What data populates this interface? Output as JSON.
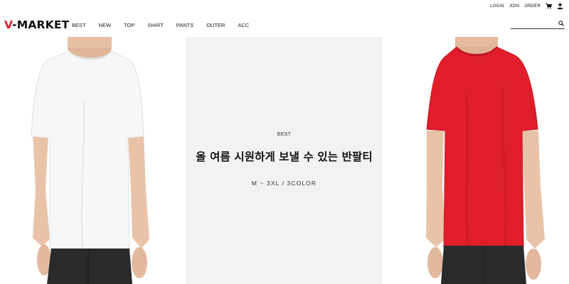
{
  "util_bar": {
    "login": "LOGIN",
    "join": "JOIN",
    "order": "ORDER",
    "icons": [
      "cart-icon",
      "user-icon"
    ]
  },
  "header": {
    "logo_prefix": "V",
    "logo_rest": "-MARKET",
    "nav": [
      "BEST",
      "NEW",
      "TOP",
      "SHIRT",
      "PANTS",
      "OUTER",
      "ACC"
    ],
    "search": {
      "value": "",
      "placeholder": "",
      "icon": "search-icon"
    }
  },
  "hero": {
    "eyebrow": "BEST",
    "headline": "올 여름 시원하게 보낼 수 있는 반팔티",
    "subline": "M ~ 3XL / 3COLOR",
    "left_image": "model-white-tshirt",
    "right_image": "model-red-tshirt"
  },
  "colors": {
    "brand_accent": "#e01f2d",
    "center_panel_bg": "#f2f2f2",
    "white_tshirt": "#f7f7f7",
    "red_tshirt": "#e01e2b",
    "skin": "#e9c3a8",
    "pants": "#2a2a2a"
  }
}
